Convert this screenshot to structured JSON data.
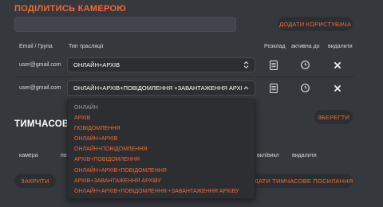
{
  "share_camera": {
    "title": "ПОДІЛИТИСЬ КАМЕРОЮ",
    "email_input": {
      "value": "",
      "placeholder": ""
    },
    "add_user_label": "ДОДАТИ КОРИСТУВАЧА",
    "headers": {
      "email_group": "Email / Група",
      "stream_type": "Тип трасляції",
      "schedule": "Розклад",
      "active_until": "активна до",
      "delete": "видалити"
    },
    "rows": [
      {
        "email": "user@gmail.com",
        "stream_type": "ОНЛАЙН+АРХІВ"
      },
      {
        "email": "user@gmail.com",
        "stream_type": "ОНЛАЙН+АРХІВ+ПОВІДОМЛЕННЯ +ЗАВАНТАЖЕННЯ АРХІВУ"
      }
    ]
  },
  "temporary_links": {
    "title": "ТИМЧАСОВЕ П",
    "save_label": "ЗБЕРЕГТИ",
    "headers": {
      "camera": "камера",
      "col2": "по",
      "on_off": "вкл/викл",
      "delete": "видалити"
    },
    "close_label": "ЗАКРИТИ",
    "add_link_label": "ДОДАТИ ТИМЧАСОВЕ ПОСИЛАННЯ"
  },
  "dropdown": {
    "options": [
      "ОНЛАЙН",
      "АРХІВ",
      "ПОВІДОМЛЕННЯ",
      "ОНЛАЙН+АРХІВ",
      "ОНЛАЙН+ПОВІДОМЛЕННЯ",
      "АРХІВ+ПОВІДОМЛЕННЯ",
      "ОНЛАЙН+АРХІВ+ПОВІДОМЛЕННЯ",
      "АРХІВ+ЗАВАНТАЖЕННЯ АРХІВУ",
      "ОНЛАЙН+АРХІВ+ПОВІДОМЛЕННЯ +ЗАВАНТАЖЕННЯ АРХІВУ"
    ]
  },
  "colors": {
    "background": "#35383d",
    "accent": "#f26a36",
    "control": "#2c2e32"
  },
  "icons": {
    "schedule": "calendar-icon",
    "active_until": "clock-icon",
    "delete": "close-icon",
    "select": "chevron-icon"
  }
}
